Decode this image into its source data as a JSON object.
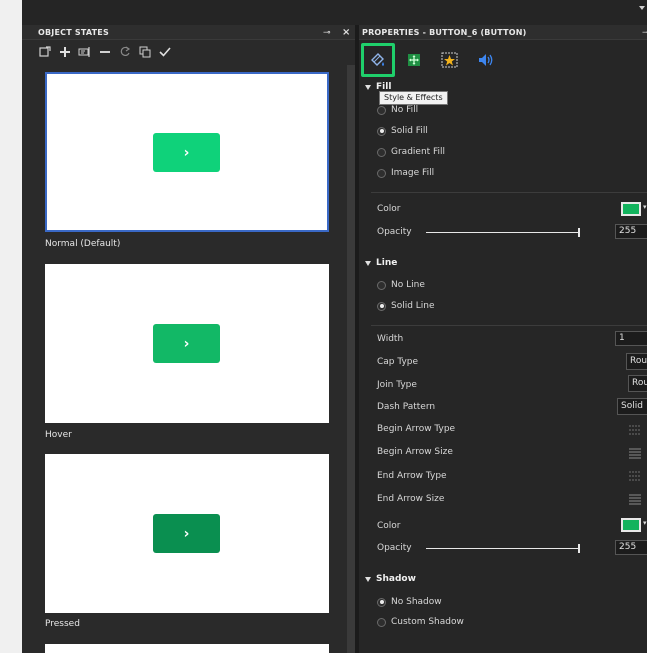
{
  "object_states": {
    "title": "OBJECT STATES",
    "toolbar": [
      "new-state-icon",
      "add-icon",
      "rename-icon",
      "remove-icon",
      "reset-icon",
      "copy-icon",
      "done-icon"
    ],
    "states": [
      {
        "label": "Normal (Default)",
        "button_glyph": "›",
        "button_color": "#0fd27a",
        "selected": true
      },
      {
        "label": "Hover",
        "button_glyph": "›",
        "button_color": "#12b866",
        "selected": false
      },
      {
        "label": "Pressed",
        "button_glyph": "›",
        "button_color": "#0a8f50",
        "selected": false
      }
    ]
  },
  "properties": {
    "title": "PROPERTIES - BUTTON_6 (BUTTON)",
    "tabs": [
      "style-effects-icon",
      "position-size-icon",
      "states-icon",
      "audio-icon"
    ],
    "tooltip": "Style & Effects",
    "fill": {
      "heading": "Fill",
      "options": [
        "No Fill",
        "Solid Fill",
        "Gradient Fill",
        "Image Fill"
      ],
      "selected": "Solid Fill",
      "color_label": "Color",
      "color": "#12b35d",
      "opacity_label": "Opacity",
      "opacity": "255"
    },
    "line": {
      "heading": "Line",
      "options": [
        "No Line",
        "Solid Line"
      ],
      "selected": "Solid Line",
      "width_label": "Width",
      "width": "1",
      "cap_type_label": "Cap Type",
      "cap_type": "Round",
      "join_type_label": "Join Type",
      "join_type": "Round",
      "dash_pattern_label": "Dash Pattern",
      "dash_pattern": "Solid",
      "begin_arrow_type_label": "Begin Arrow Type",
      "begin_arrow_size_label": "Begin Arrow Size",
      "end_arrow_type_label": "End Arrow Type",
      "end_arrow_size_label": "End Arrow Size",
      "color_label": "Color",
      "color": "#12b35d",
      "opacity_label": "Opacity",
      "opacity": "255"
    },
    "shadow": {
      "heading": "Shadow",
      "options": [
        "No Shadow",
        "Custom Shadow"
      ],
      "selected": "No Shadow"
    }
  },
  "colors": {
    "accent_highlight": "#1fcf6b",
    "selection_border": "#3a69c6"
  }
}
